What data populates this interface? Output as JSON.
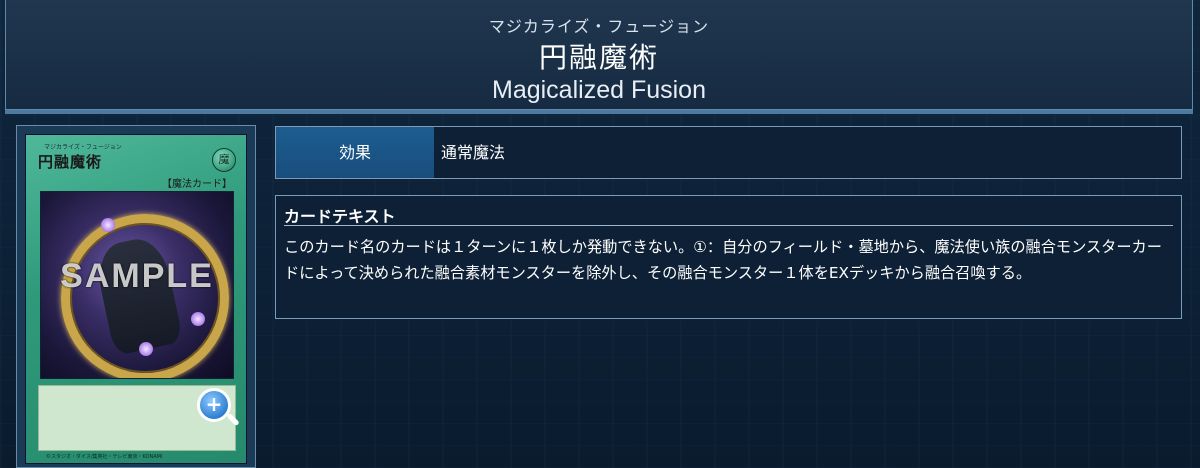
{
  "header": {
    "ruby": "マジカライズ・フュージョン",
    "name_jp": "円融魔術",
    "name_en": "Magicalized Fusion"
  },
  "card_image": {
    "ruby": "マジカライズ・フュージョン",
    "name": "円融魔術",
    "attribute": "魔",
    "type_line": "【魔法カード】",
    "watermark": "SAMPLE",
    "copyright": "©スタジオ・ダイス/集英社・テレビ東京・KONAMI"
  },
  "zoom": {
    "icon": "zoom-in-icon",
    "symbol": "+"
  },
  "effect": {
    "label": "効果",
    "value": "通常魔法"
  },
  "card_text": {
    "heading": "カードテキスト",
    "body": "このカード名のカードは１ターンに１枚しか発動できない。①：自分のフィールド・墓地から、魔法使い族の融合モンスターカードによって決められた融合素材モンスターを除外し、その融合モンスター１体をEXデッキから融合召喚する。"
  },
  "colors": {
    "background": "#0d2238",
    "header": "#1b3149",
    "label_blue": "#1e5c90",
    "border": "#7b9bb8"
  }
}
